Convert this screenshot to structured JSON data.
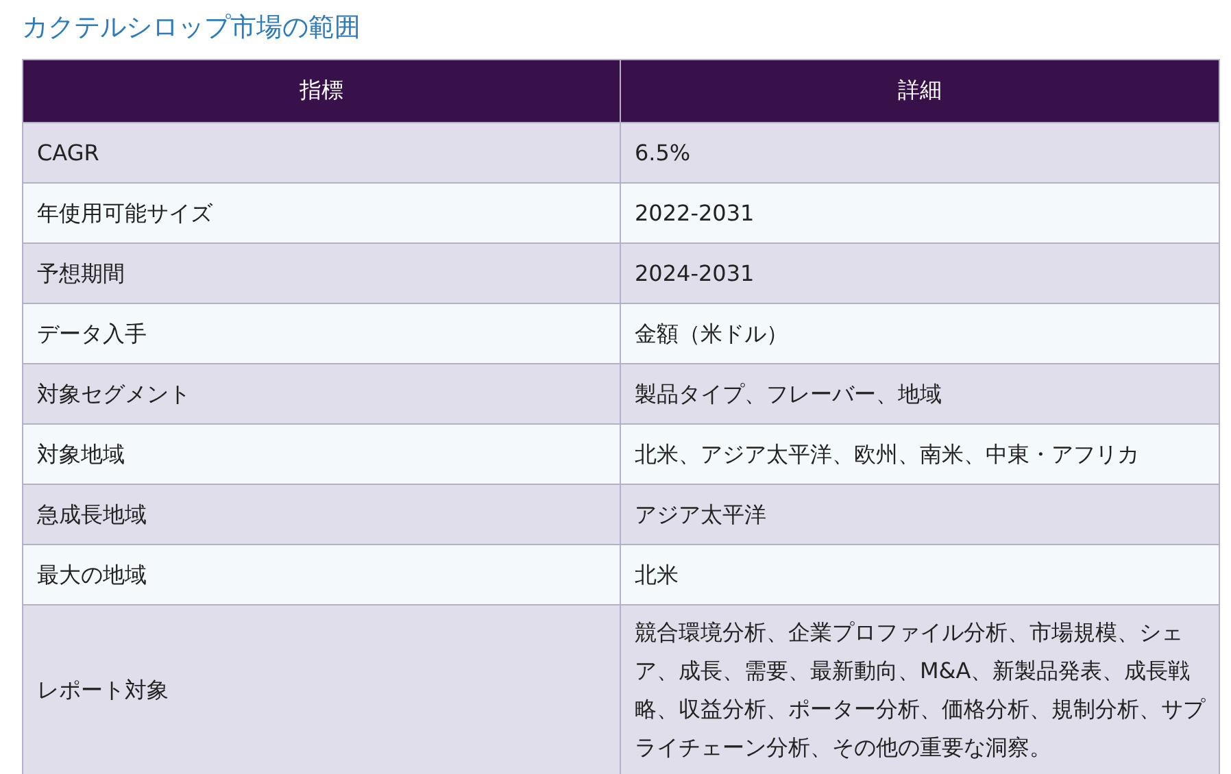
{
  "title": "カクテルシロップ市場の範囲",
  "table": {
    "columns": [
      "指標",
      "詳細"
    ],
    "rows": [
      [
        "CAGR",
        "6.5%"
      ],
      [
        "年使用可能サイズ",
        "2022-2031"
      ],
      [
        "予想期間",
        "2024-2031"
      ],
      [
        "データ入手",
        "金額（米ドル）"
      ],
      [
        "対象セグメント",
        "製品タイプ、フレーバー、地域"
      ],
      [
        "対象地域",
        "北米、アジア太平洋、欧州、南米、中東・アフリカ"
      ],
      [
        "急成長地域",
        "アジア太平洋"
      ],
      [
        "最大の地域",
        "北米"
      ],
      [
        "レポート対象",
        "競合環境分析、企業プロファイル分析、市場規模、シェア、成長、需要、最新動向、M&A、新製品発表、成長戦略、収益分析、ポーター分析、価格分析、規制分析、サプライチェーン分析、その他の重要な洞察。"
      ]
    ]
  }
}
